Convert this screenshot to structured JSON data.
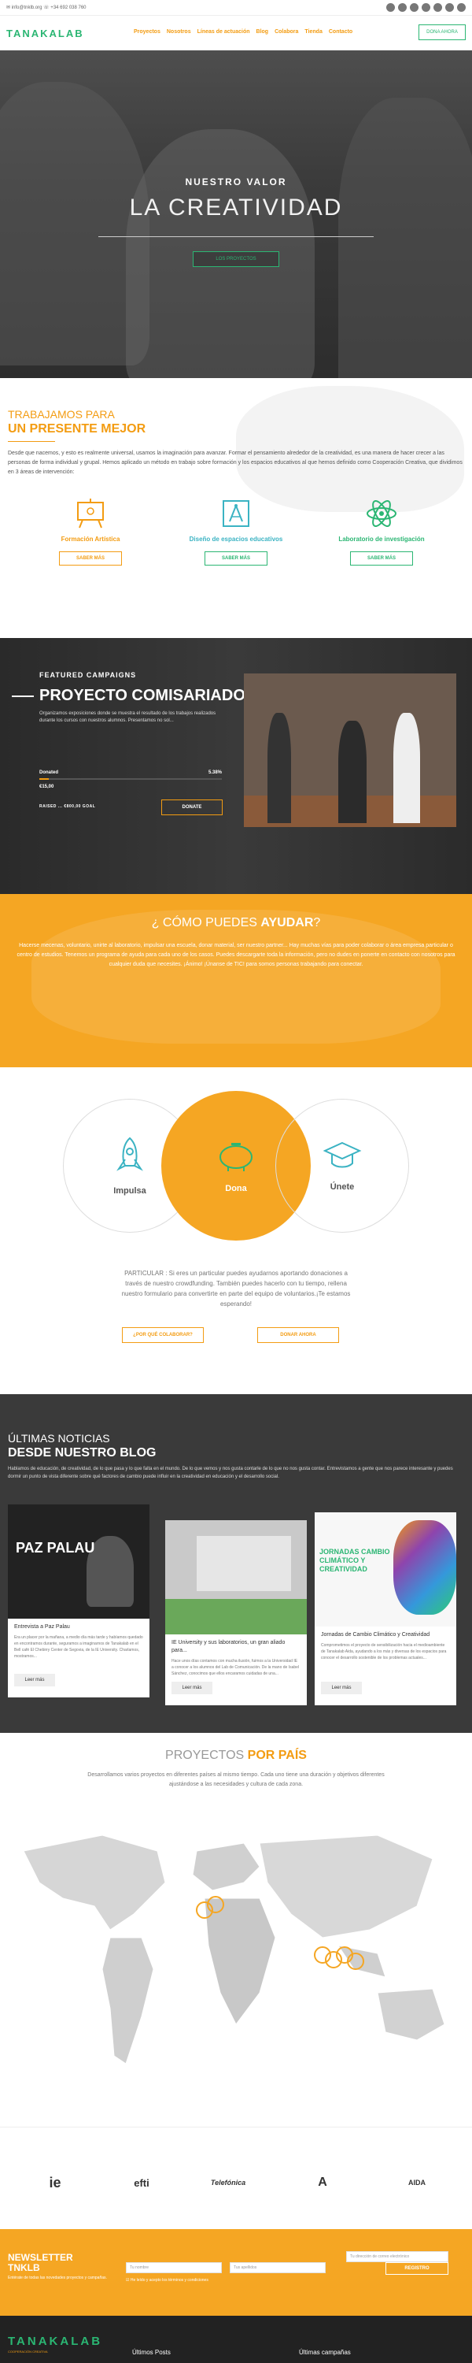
{
  "topbar": {
    "contact": "✉ info@tnklb.org   ☏ +34 692 038 760",
    "social_icons": [
      "facebook-icon",
      "twitter-icon",
      "instagram-icon",
      "linkedin-icon",
      "youtube-icon",
      "vimeo-icon",
      "email-icon"
    ]
  },
  "nav": {
    "logo": "TANAKALAB",
    "items": [
      "Proyectos",
      "Nosotros",
      "Líneas de actuación",
      "Blog",
      "Colabora",
      "Tienda",
      "Contacto"
    ],
    "donate": "DONA AHORA"
  },
  "hero": {
    "tag1": "NUESTRO VALOR",
    "tag2": "LA CREATIVIDAD",
    "button": "LOS PROYECTOS"
  },
  "intro": {
    "title1": "TRABAJAMOS PARA",
    "title2": "UN PRESENTE MEJOR",
    "text": "Desde que nacemos, y esto es realmente universal, usamos la imaginación para avanzar. Formar el pensamiento alrededor de la creatividad, es una manera de hacer crecer a las personas de forma individual y grupal. Hemos aplicado un método en trabajo sobre formación y los espacios educativos al que hemos definido como Cooperación Creativa, que dividimos en 3 áreas de intervención:",
    "cards": [
      {
        "title": "Formación Artística",
        "button": "SABER MÁS",
        "color": "#f39c12"
      },
      {
        "title": "Diseño de espacios educativos",
        "button": "SABER MÁS",
        "color": "#3bb3c3"
      },
      {
        "title": "Laboratorio de investigación",
        "button": "SABER MÁS",
        "color": "#2bb673"
      }
    ]
  },
  "campaign": {
    "label": "FEATURED CAMPAIGNS",
    "title": "PROYECTO COMISARIADO",
    "desc": "Organizamos exposiciones donde se muestra el resultado de los trabajos realizados durante los cursos con nuestros alumnos. Presentamos no sol...",
    "donated_label": "Donated",
    "donated_pct": "5.38%",
    "progress": 0.0538,
    "amount": "€15,00",
    "raised": "RAISED   ...   €800,00   GOAL",
    "donate": "DONATE"
  },
  "help": {
    "title_pre": "¿ CÓMO",
    "title_mid": "PUEDES",
    "title_bold": "AYUDAR",
    "title_end": "?",
    "text": "Hacerse mecenas, voluntario, unirte al laboratorio, impulsar una escuela, donar material, ser nuestro partner... Hay muchas vías para poder colaborar o área empresa particular o centro de estudios. Tenemos un programa de ayuda para cada uno de los casos. Puedes descargarte toda la información, pero no dudes en ponerte en contacto con nosotros para cualquier duda que necesites. ¡Ánimo! ¡Únanse de TIC! para somos personas trabajando para conectar."
  },
  "actions": {
    "items": [
      "Impulsa",
      "Dona",
      "Únete"
    ],
    "text": "PARTICULAR : Si eres un particular puedes ayudarnos aportando donaciones a través de nuestro crowdfunding. También puedes hacerlo con tu tiempo, rellena nuestro formulario para convertirte en parte del equipo de voluntarios.¡Te estamos esperando!",
    "button1": "¿POR QUÉ COLABORAR?",
    "button2": "DONAR AHORA"
  },
  "blog": {
    "title1": "ÚLTIMAS NOTICIAS",
    "title2": "DESDE NUESTRO BLOG",
    "text": "Hablamos de educación, de creatividad, de lo que pasa y lo que falta en el mundo. De lo que vemos y nos gusta contarle de lo que no nos gusta contar. Entrevistamos a gente que nos parece interesante y puedes dormir un punto de vista diferente sobre qué factores de cambio puede influir en la creatividad en educación y el desarrollo social.",
    "posts": [
      {
        "image_text": "PAZ PALAU",
        "title": "Entrevista a Paz Palau",
        "text": "Era un placer por la mañana, a medio día más tarde y habíamos quedado en encontramos durante, seguramos a imaginarnos de Tanakalab en el Bell café El Chebirry Center de Segovia, de la IE University. Charlamos, mostramos...",
        "more": "Leer más"
      },
      {
        "title": "IE University y sus laboratorios, un gran aliado para...",
        "text": "Hace unos días contamos con mucha ilusión, fuimos a la Universidad IE a conocer a los alumnos del Lab de Comunicación. De la mano de Isabel Sánchez, conocimos que ellos encaramos cuidadas de una...",
        "more": "Leer más"
      },
      {
        "image_text": "JORNADAS CAMBIO CLIMÁTICO Y CREATIVIDAD",
        "title": "Jornadas de Cambio Climático y Creatividad",
        "text": "Comprometimos el proyecto de sensibilización hacia el medioambiente de Tanakalab Aida, ayudando a los más y diversas de los espacios para conocer el desarrollo sostenible de los problemas actuales...",
        "more": "Leer más"
      }
    ]
  },
  "projects": {
    "title_a": "PROYECTOS",
    "title_b": "POR PAÍS",
    "text": "Desarrollamos varios proyectos en diferentes países al mismo tiempo. Cada uno tiene una duración y objetivos diferentes ajustándose a las necesidades y cultura de cada zona."
  },
  "partners": {
    "items": [
      "ie",
      "efti",
      "Telefónica",
      "A",
      "AIDA"
    ]
  },
  "newsletter": {
    "title1": "NEWSLETTER",
    "title2": "TNKLB",
    "sub": "Entérate de todas las novedades proyectos y campañas.",
    "field_name": "Tu nombre",
    "field_surname": "Tus apellidos",
    "field_email": "Tu dirección de correo electrónico",
    "check": "He leído y acepto los términos y condiciones",
    "button": "REGISTRO"
  },
  "footer": {
    "logo": "TANAKALAB",
    "tagline": "COOPERACIÓN CREATIVA",
    "col1": "Últimos Posts",
    "col2": "Últimas campañas"
  }
}
